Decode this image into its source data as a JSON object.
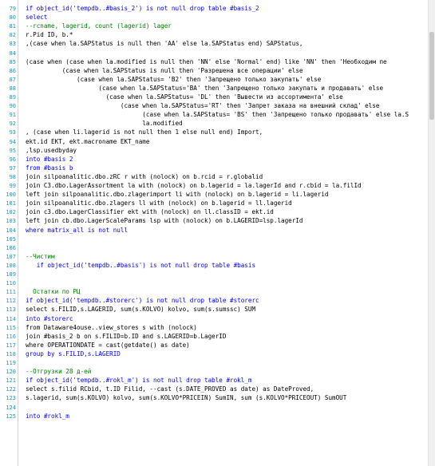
{
  "lines": [
    {
      "n": "79",
      "t": "if object_id('tempdb..#basis_2') is not null drop table #basis_2",
      "c": "kw"
    },
    {
      "n": "80",
      "t": "select",
      "c": "kw"
    },
    {
      "n": "81",
      "t": "--rcname, lagerid, count (lagerid) lager",
      "c": "cm"
    },
    {
      "n": "82",
      "t": "r.Pid ID, b.*",
      "c": ""
    },
    {
      "n": "83",
      "t": ",(case when la.SAPStatus is null then 'AA' else la.SAPStatus end) SAPStatus,",
      "c": ""
    },
    {
      "n": "84",
      "t": "",
      "c": ""
    },
    {
      "n": "85",
      "t": "(case when (case when la.modified is null then 'NN' else 'Normal' end) like 'NN' then 'Необходим пе",
      "c": ""
    },
    {
      "n": "86",
      "t": "          (case when la.SAPStatus is null then 'Разрешена все операции' else",
      "c": ""
    },
    {
      "n": "87",
      "t": "              (case when la.SAPStatus= 'B2' then 'Запрещено только закупать' else",
      "c": ""
    },
    {
      "n": "88",
      "t": "                    (case when la.SAPStatus='BA' then 'Запрещено только закупать и продавать' else",
      "c": ""
    },
    {
      "n": "89",
      "t": "                      (case when la.SAPStatus= 'DL' then 'Вывести из ассортимента' else",
      "c": ""
    },
    {
      "n": "90",
      "t": "                          (case when la.SAPStatus='RT' then 'Запрет заказа на внешний склад' else",
      "c": ""
    },
    {
      "n": "91",
      "t": "                                (case when la.SAPStatus= 'BS' then 'Запрещено только продавать' else la.S",
      "c": ""
    },
    {
      "n": "92",
      "t": "                                la.modified",
      "c": ""
    },
    {
      "n": "93",
      "t": ", (case when li.lagerid is not null then 1 else null end) Import,",
      "c": ""
    },
    {
      "n": "94",
      "t": "ekt.id EKT, ekt.macroname EKT_name",
      "c": ""
    },
    {
      "n": "95",
      "t": ",lsp.usedbyday",
      "c": ""
    },
    {
      "n": "96",
      "t": "into #basis 2",
      "c": "kw"
    },
    {
      "n": "97",
      "t": "from #basis b",
      "c": "kw"
    },
    {
      "n": "98",
      "t": "join silpoanalitic.dbo.zRC r with (nolock) on b.rcid = r.globalid",
      "c": ""
    },
    {
      "n": "99",
      "t": "join C3.dbo.LagerAssortment la with (nolock) on b.lagerid = la.lagerId and r.cbid = la.filId",
      "c": ""
    },
    {
      "n": "100",
      "t": "left join silpoanalitic.dbo.zlagerimport li with (nolock) on b.lagerid = li.lagerid",
      "c": ""
    },
    {
      "n": "101",
      "t": "join silpoanalitic.dbo.zlagers ll with (nolock) on b.lagerid = ll.lagerid",
      "c": ""
    },
    {
      "n": "102",
      "t": "join c3.dbo.LagerClassifier ekt with (nolock) on ll.classID = ekt.id",
      "c": ""
    },
    {
      "n": "103",
      "t": "left join cb.dbo.LagerScaleParams lsp with (nolock) on b.LAGERID=lsp.lagerId",
      "c": ""
    },
    {
      "n": "104",
      "t": "where matrix_all is not null",
      "c": "kw"
    },
    {
      "n": "105",
      "t": "",
      "c": ""
    },
    {
      "n": "106",
      "t": "",
      "c": ""
    },
    {
      "n": "107",
      "t": "--Чистим",
      "c": "cm"
    },
    {
      "n": "108",
      "t": "   if object_id('tempdb..#basis') is not null drop table #basis",
      "c": "kw"
    },
    {
      "n": "109",
      "t": "",
      "c": ""
    },
    {
      "n": "110",
      "t": "",
      "c": ""
    },
    {
      "n": "111",
      "t": "  Остатки по РЦ",
      "c": "cm"
    },
    {
      "n": "112",
      "t": "if object_id('tempdb..#storerc') is not null drop table #storerc",
      "c": "kw"
    },
    {
      "n": "113",
      "t": "select s.FILID,s.LAGERID, sum(s.KOLVO) kolvo, sum(s.sumssc) SUM",
      "c": ""
    },
    {
      "n": "114",
      "t": "into #storerc",
      "c": "kw"
    },
    {
      "n": "115",
      "t": "from Dataware4ouse..view_stores s with (nolock)",
      "c": ""
    },
    {
      "n": "116",
      "t": "join #basis_2 b on s.FILID=b.ID and s.LAGERID=b.LagerID",
      "c": ""
    },
    {
      "n": "117",
      "t": "where OPERATIONDATE = cast(getdate() as date)",
      "c": ""
    },
    {
      "n": "118",
      "t": "group by s.FILID,s.LAGERID",
      "c": "kw"
    },
    {
      "n": "119",
      "t": "",
      "c": ""
    },
    {
      "n": "120",
      "t": "--Отгрузки 28 д-ей",
      "c": "cm"
    },
    {
      "n": "121",
      "t": "if object_id('tempdb..#rokl_m') is not null drop table #rokl_m",
      "c": "kw"
    },
    {
      "n": "122",
      "t": "select s.filid RCbid, t.ID Filid, --cast (s.DATE_PROVED as date) as DateProved,",
      "c": ""
    },
    {
      "n": "123",
      "t": "s.lagerid, sum(s.KOLVO) kolvo, sum(s.KOLVO*PRICEIN) SumIN, sum (s.KOLVO*PRICEOUT) SumOUT",
      "c": ""
    },
    {
      "n": "124",
      "t": "",
      "c": ""
    },
    {
      "n": "125",
      "t": "into #rokl_m",
      "c": "kw"
    }
  ]
}
